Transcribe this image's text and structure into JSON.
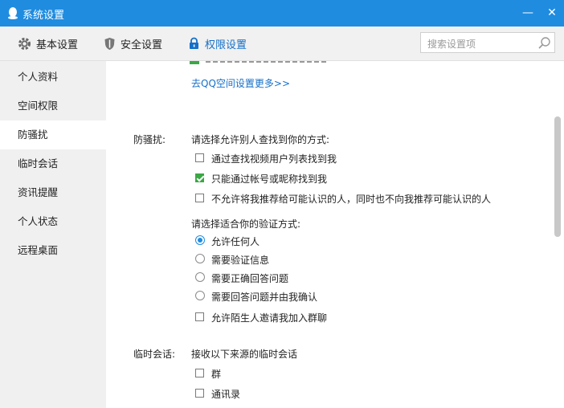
{
  "window": {
    "title": "系统设置",
    "minimize": "—",
    "close": "✕"
  },
  "toolbar": {
    "tabs": [
      {
        "label": "基本设置",
        "icon": "gear-icon"
      },
      {
        "label": "安全设置",
        "icon": "shield-icon"
      },
      {
        "label": "权限设置",
        "icon": "lock-icon",
        "active": true
      }
    ],
    "search_placeholder": "搜索设置项"
  },
  "sidebar": {
    "items": [
      "个人资料",
      "空间权限",
      "防骚扰",
      "临时会话",
      "资讯提醒",
      "个人状态",
      "远程桌面"
    ],
    "active_index": 2
  },
  "content": {
    "qzone_link": "去QQ空间设置更多>>",
    "harass": {
      "label": "防骚扰:",
      "find_prompt": "请选择允许别人查找到你的方式:",
      "find_options": [
        {
          "label": "通过查找视频用户列表找到我",
          "checked": false
        },
        {
          "label": "只能通过帐号或昵称找到我",
          "checked": true
        },
        {
          "label": "不允许将我推荐给可能认识的人，同时也不向我推荐可能认识的人",
          "checked": false
        }
      ],
      "verify_prompt": "请选择适合你的验证方式:",
      "verify_options": [
        {
          "label": "允许任何人",
          "selected": true
        },
        {
          "label": "需要验证信息",
          "selected": false
        },
        {
          "label": "需要正确回答问题",
          "selected": false
        },
        {
          "label": "需要回答问题并由我确认",
          "selected": false
        }
      ],
      "group_invite": {
        "label": "允许陌生人邀请我加入群聊",
        "checked": false
      }
    },
    "temp": {
      "label": "临时会话:",
      "prompt": "接收以下来源的临时会话",
      "options": [
        {
          "label": "群",
          "checked": false
        },
        {
          "label": "通讯录",
          "checked": false
        }
      ]
    }
  },
  "colors": {
    "titlebar": "#1f8ce0",
    "accent": "#1570c9",
    "check": "#3aa845"
  }
}
